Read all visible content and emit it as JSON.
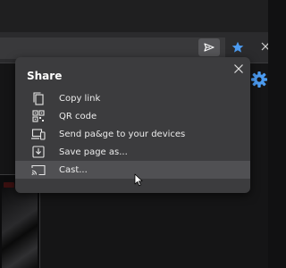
{
  "dialog": {
    "title": "Share",
    "items": [
      {
        "label": "Copy link",
        "icon": "copy-icon"
      },
      {
        "label": "QR code",
        "icon": "qr-code-icon"
      },
      {
        "label": "Send pa&ge to your devices",
        "icon": "devices-icon"
      },
      {
        "label": "Save page as...",
        "icon": "save-icon"
      },
      {
        "label": "Cast...",
        "icon": "cast-icon"
      }
    ],
    "hovered_item": "Cast..."
  },
  "toolbar": {
    "icons": [
      "send-icon",
      "favorite-star-icon",
      "more-icon",
      "settings-gear-icon"
    ]
  },
  "colors": {
    "dialog_bg": "#3c3c3e",
    "hover_bg": "#505053",
    "star": "#4c9bf0",
    "text": "#ececec"
  }
}
